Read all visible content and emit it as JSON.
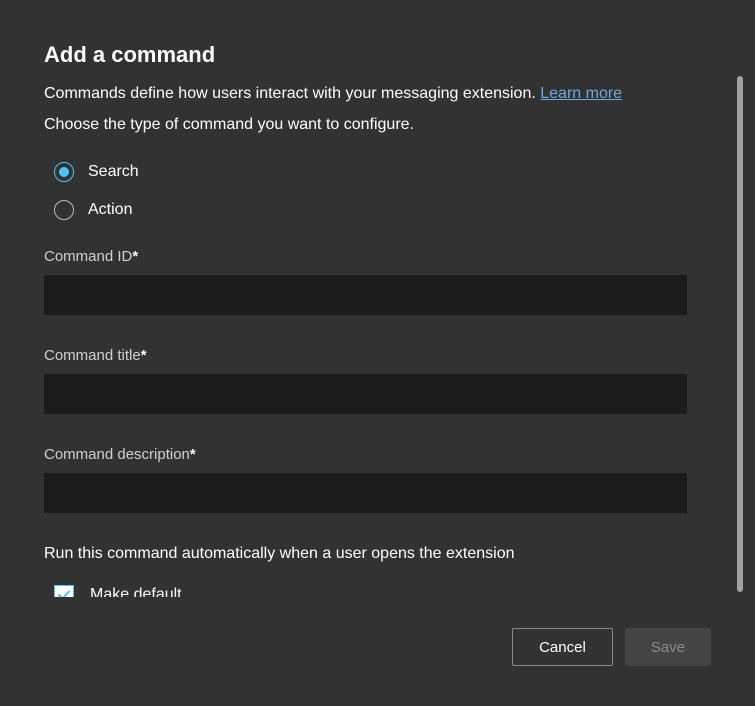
{
  "dialog": {
    "title": "Add a command",
    "description": "Commands define how users interact with your messaging extension. ",
    "learn_more": "Learn more",
    "subdescription": "Choose the type of command you want to configure."
  },
  "radio": {
    "options": [
      {
        "label": "Search",
        "selected": true
      },
      {
        "label": "Action",
        "selected": false
      }
    ]
  },
  "fields": {
    "command_id": {
      "label": "Command ID",
      "required": true,
      "value": ""
    },
    "command_title": {
      "label": "Command title",
      "required": true,
      "value": ""
    },
    "command_description": {
      "label": "Command description",
      "required": true,
      "value": ""
    }
  },
  "auto_run": {
    "section_label": "Run this command automatically when a user opens the extension",
    "checkbox_label": "Make default",
    "checked": true
  },
  "footer": {
    "cancel": "Cancel",
    "save": "Save"
  }
}
